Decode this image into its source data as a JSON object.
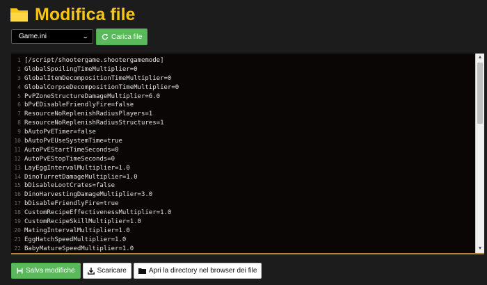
{
  "header": {
    "title": "Modifica file",
    "icon": "folder-open-icon",
    "accent_color": "#f5c518"
  },
  "toolbar": {
    "file_select": {
      "selected": "Game.ini"
    },
    "load_button": {
      "label": "Carica file",
      "icon": "refresh-icon"
    }
  },
  "editor": {
    "lines": [
      {
        "n": "1",
        "text": "[/script/shootergame.shootergamemode]"
      },
      {
        "n": "2",
        "text": "GlobalSpoilingTimeMultiplier=0"
      },
      {
        "n": "3",
        "text": "GlobalItemDecompositionTimeMultiplier=0"
      },
      {
        "n": "4",
        "text": "GlobalCorpseDecompositionTimeMultiplier=0"
      },
      {
        "n": "5",
        "text": "PvPZoneStructureDamageMultiplier=6.0"
      },
      {
        "n": "6",
        "text": "bPvEDisableFriendlyFire=false"
      },
      {
        "n": "7",
        "text": "ResourceNoReplenishRadiusPlayers=1"
      },
      {
        "n": "8",
        "text": "ResourceNoReplenishRadiusStructures=1"
      },
      {
        "n": "9",
        "text": "bAutoPvETimer=false"
      },
      {
        "n": "10",
        "text": "bAutoPvEUseSystemTime=true"
      },
      {
        "n": "11",
        "text": "AutoPvEStartTimeSeconds=0"
      },
      {
        "n": "12",
        "text": "AutoPvEStopTimeSeconds=0"
      },
      {
        "n": "13",
        "text": "LayEggIntervalMultiplier=1.0"
      },
      {
        "n": "14",
        "text": "DinoTurretDamageMultiplier=1.0"
      },
      {
        "n": "15",
        "text": "bDisableLootCrates=false"
      },
      {
        "n": "16",
        "text": "DinoHarvestingDamageMultiplier=3.0"
      },
      {
        "n": "17",
        "text": "bDisableFriendlyFire=true"
      },
      {
        "n": "18",
        "text": "CustomRecipeEffectivenessMultiplier=1.0"
      },
      {
        "n": "19",
        "text": "CustomRecipeSkillMultiplier=1.0"
      },
      {
        "n": "20",
        "text": "MatingIntervalMultiplier=1.0"
      },
      {
        "n": "21",
        "text": "EggHatchSpeedMultiplier=1.0"
      },
      {
        "n": "22",
        "text": "BabyMatureSpeedMultiplier=1.0"
      }
    ]
  },
  "actions": {
    "save": {
      "label": "Salva modifiche",
      "icon": "save-icon"
    },
    "download": {
      "label": "Scaricare",
      "icon": "download-icon"
    },
    "open_dir": {
      "label": "Apri la directory nel browser dei file",
      "icon": "folder-icon"
    }
  }
}
